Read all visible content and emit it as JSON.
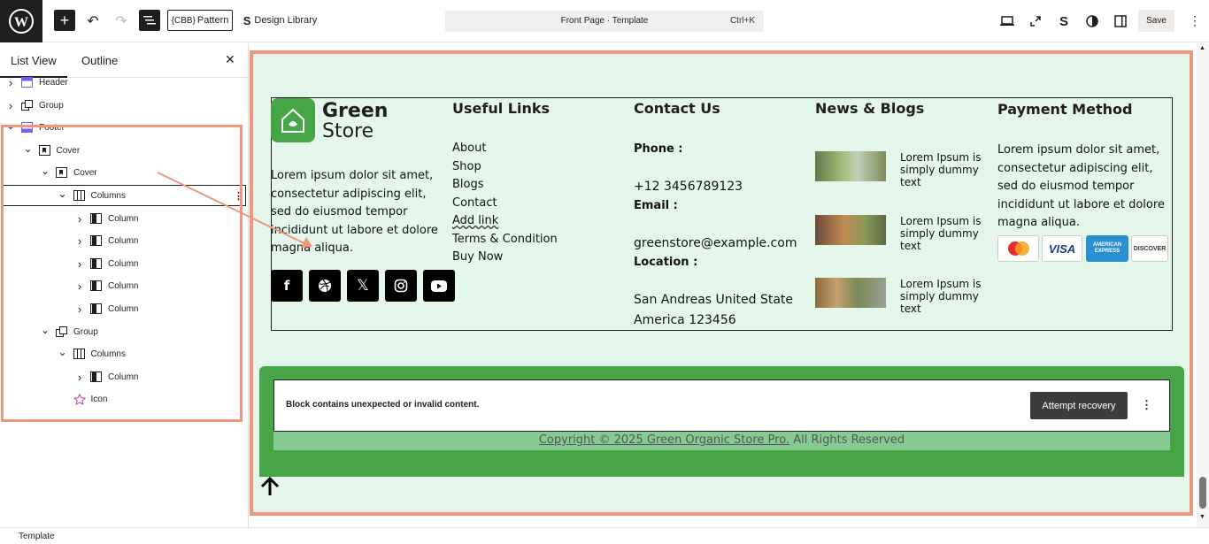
{
  "topbar": {
    "pattern_label": "Pattern",
    "pattern_prefix": "{CBB}",
    "design_library_label": "Design Library",
    "document_title": "Front Page · Template",
    "shortcut": "Ctrl+K",
    "save_label": "Save"
  },
  "sidebar": {
    "tabs": [
      "List View",
      "Outline"
    ],
    "tree": [
      {
        "label": "Header",
        "depth": 0,
        "icon": "header-icon",
        "expanded": false
      },
      {
        "label": "Group",
        "depth": 0,
        "icon": "group-icon",
        "expanded": false
      },
      {
        "label": "Footer",
        "depth": 0,
        "icon": "footer-icon",
        "expanded": true
      },
      {
        "label": "Cover",
        "depth": 1,
        "icon": "cover-icon",
        "expanded": true
      },
      {
        "label": "Cover",
        "depth": 2,
        "icon": "cover-icon",
        "expanded": true
      },
      {
        "label": "Columns",
        "depth": 3,
        "icon": "columns-icon",
        "expanded": true,
        "selected": true
      },
      {
        "label": "Column",
        "depth": 4,
        "icon": "column-icon",
        "expanded": false
      },
      {
        "label": "Column",
        "depth": 4,
        "icon": "column-icon",
        "expanded": false
      },
      {
        "label": "Column",
        "depth": 4,
        "icon": "column-icon",
        "expanded": false
      },
      {
        "label": "Column",
        "depth": 4,
        "icon": "column-icon",
        "expanded": false
      },
      {
        "label": "Column",
        "depth": 4,
        "icon": "column-icon",
        "expanded": false
      },
      {
        "label": "Group",
        "depth": 2,
        "icon": "group-icon",
        "expanded": true
      },
      {
        "label": "Columns",
        "depth": 3,
        "icon": "columns-icon",
        "expanded": true
      },
      {
        "label": "Column",
        "depth": 4,
        "icon": "column-icon",
        "expanded": false
      },
      {
        "label": "Icon",
        "depth": 3,
        "icon": "star-icon",
        "expanded": null
      }
    ]
  },
  "status": {
    "label": "Template"
  },
  "footer": {
    "logo_line1": "Green",
    "logo_line2": "Store",
    "about_text": "Lorem ipsum dolor sit amet, consectetur adipiscing elit, sed do eiusmod tempor incididunt ut labore et dolore magna aliqua.",
    "useful_links_heading": "Useful Links",
    "links": [
      "About",
      "Shop",
      "Blogs",
      "Contact",
      "Add link",
      "Terms & Condition",
      "Buy Now"
    ],
    "contact_heading": "Contact Us",
    "phone_label": "Phone :",
    "phone_value": "+12 3456789123",
    "email_label": "Email :",
    "email_value": "greenstore@example.com",
    "location_label": "Location :",
    "location_line1": "San Andreas United State",
    "location_line2": "America 123456",
    "news_heading": "News & Blogs",
    "news_items": [
      "Lorem Ipsum is simply dummy text",
      "Lorem Ipsum is simply dummy text",
      "Lorem Ipsum is simply dummy text"
    ],
    "payment_heading": "Payment Method",
    "payment_text": "Lorem ipsum dolor sit amet, consectetur adipiscing elit, sed do eiusmod tempor incididunt ut labore et dolore magna aliqua.",
    "payment_cards": [
      "MasterCard",
      "VISA",
      "AMERICAN EXPRESS",
      "DISCOVER"
    ]
  },
  "warning": {
    "message": "Block contains unexpected or invalid content.",
    "recovery_label": "Attempt recovery"
  },
  "copyright": {
    "link_text": "Copyright © 2025 Green Organic Store Pro.",
    "suffix": " All Rights Reserved"
  },
  "colors": {
    "highlight": "#f0967a",
    "canvas_bg": "#e5f7ea",
    "brand_green": "#46a647",
    "copyright_bg": "#86cc92"
  }
}
